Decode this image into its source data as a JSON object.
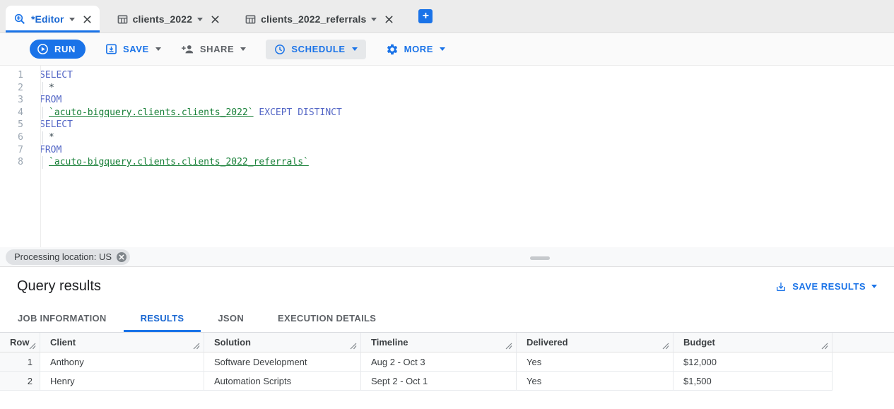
{
  "colors": {
    "accent_blue": "#1a73e8",
    "active_tab_blue": "#1967d2",
    "keyword_blue": "#5467c6",
    "table_ref_green": "#188038",
    "gray_text": "#5f6368"
  },
  "tabbar": {
    "tabs": [
      {
        "label": "*Editor",
        "icon": "query-icon",
        "active": true
      },
      {
        "label": "clients_2022",
        "icon": "table-icon",
        "active": false
      },
      {
        "label": "clients_2022_referrals",
        "icon": "table-icon",
        "active": false
      }
    ],
    "new_tab_label": "+"
  },
  "toolbar": {
    "run_label": "RUN",
    "run_icon": "play-icon",
    "save_label": "SAVE",
    "save_icon": "save-icon",
    "share_label": "SHARE",
    "share_icon": "person-add-icon",
    "schedule_label": "SCHEDULE",
    "schedule_icon": "clock-icon",
    "more_label": "MORE",
    "more_icon": "gear-icon"
  },
  "editor": {
    "lines": [
      {
        "num": "1",
        "indent": false,
        "tokens": [
          {
            "type": "keyword",
            "text": "SELECT"
          }
        ]
      },
      {
        "num": "2",
        "indent": true,
        "tokens": [
          {
            "type": "plain",
            "text": "*"
          }
        ]
      },
      {
        "num": "3",
        "indent": false,
        "tokens": [
          {
            "type": "keyword",
            "text": "FROM"
          }
        ]
      },
      {
        "num": "4",
        "indent": true,
        "tokens": [
          {
            "type": "table",
            "text": "`acuto-bigquery.clients.clients_2022`"
          },
          {
            "type": "keyword",
            "text": " EXCEPT DISTINCT"
          }
        ]
      },
      {
        "num": "5",
        "indent": false,
        "tokens": [
          {
            "type": "keyword",
            "text": "SELECT"
          }
        ]
      },
      {
        "num": "6",
        "indent": true,
        "tokens": [
          {
            "type": "plain",
            "text": "*"
          }
        ]
      },
      {
        "num": "7",
        "indent": false,
        "tokens": [
          {
            "type": "keyword",
            "text": "FROM"
          }
        ]
      },
      {
        "num": "8",
        "indent": true,
        "tokens": [
          {
            "type": "table",
            "text": "`acuto-bigquery.clients.clients_2022_referrals`"
          }
        ]
      }
    ]
  },
  "status_bar": {
    "processing_location": "Processing location: US",
    "close_icon": "close-circle-icon"
  },
  "results": {
    "title": "Query results",
    "save_results_label": "SAVE RESULTS",
    "save_results_icon": "download-icon",
    "tabs": [
      {
        "label": "JOB INFORMATION",
        "active": false
      },
      {
        "label": "RESULTS",
        "active": true
      },
      {
        "label": "JSON",
        "active": false
      },
      {
        "label": "EXECUTION DETAILS",
        "active": false
      }
    ],
    "table": {
      "columns": [
        "Row",
        "Client",
        "Solution",
        "Timeline",
        "Delivered",
        "Budget"
      ],
      "rows": [
        [
          "1",
          "Anthony",
          "Software Development",
          "Aug 2 - Oct 3",
          "Yes",
          "$12,000"
        ],
        [
          "2",
          "Henry",
          "Automation Scripts",
          "Sept 2 - Oct 1",
          "Yes",
          "$1,500"
        ]
      ]
    }
  }
}
